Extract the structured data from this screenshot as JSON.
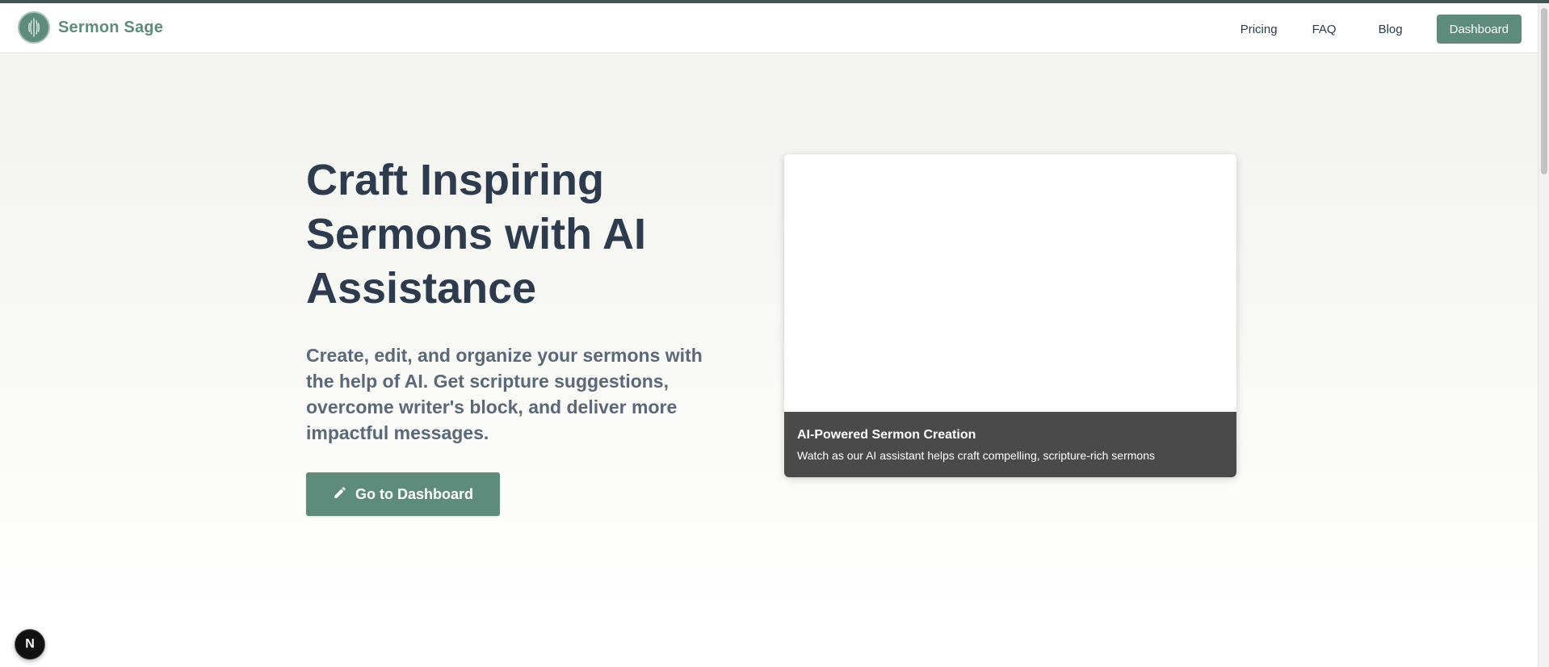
{
  "brand": {
    "name": "Sermon Sage",
    "logo_icon": "wheat-leaf-icon",
    "color": "#5d8b7c"
  },
  "nav": {
    "links": [
      "Pricing",
      "FAQ",
      "Blog"
    ],
    "cta_label": "Dashboard"
  },
  "hero": {
    "title": "Craft Inspiring Sermons with AI Assistance",
    "subtitle": "Create, edit, and organize your sermons with the help of AI. Get scripture suggestions, overcome writer's block, and deliver more impactful messages.",
    "cta_label": "Go to Dashboard",
    "cta_icon": "pencil-icon"
  },
  "media": {
    "caption_title": "AI-Powered Sermon Creation",
    "caption_desc": "Watch as our AI assistant helps craft compelling, scripture-rich sermons"
  },
  "dev_badge": {
    "label": "N"
  },
  "colors": {
    "accent": "#5d8b7c",
    "heading": "#2c3b4e",
    "subtext": "#5b6878",
    "caption_bg": "#4a4a4a"
  }
}
